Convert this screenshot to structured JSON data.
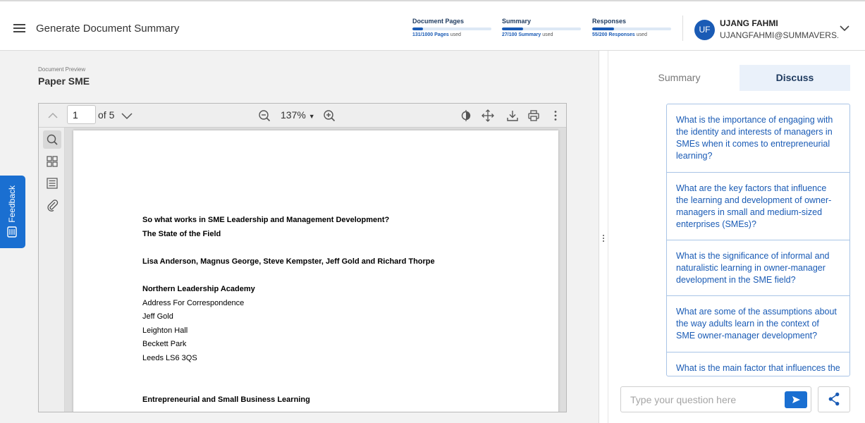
{
  "header": {
    "title": "Generate Document Summary",
    "usage": [
      {
        "label": "Document Pages",
        "used_value": "131/1000 Pages",
        "suffix": "used",
        "fraction": 0.131
      },
      {
        "label": "Summary",
        "used_value": "27/100 Summary",
        "suffix": "used",
        "fraction": 0.27
      },
      {
        "label": "Responses",
        "used_value": "55/200 Responses",
        "suffix": "used",
        "fraction": 0.275
      }
    ],
    "user": {
      "initials": "UF",
      "name": "UJANG FAHMI",
      "email": "UJANGFAHMI@SUMMAVERS..."
    }
  },
  "preview": {
    "label": "Document Preview",
    "title": "Paper SME"
  },
  "viewer": {
    "page_value": "1",
    "page_of": "of 5",
    "zoom": "137%",
    "document_lines": [
      {
        "text": "So what works in SME Leadership and Management Development?",
        "bold": true
      },
      {
        "text": "The State of the Field",
        "bold": true
      },
      {
        "text": "Lisa Anderson, Magnus George, Steve Kempster, Jeff Gold and Richard Thorpe",
        "bold": true
      },
      {
        "text": "Northern Leadership Academy",
        "bold": true
      },
      {
        "text": "Address For Correspondence",
        "bold": false
      },
      {
        "text": "Jeff Gold",
        "bold": false
      },
      {
        "text": "Leighton Hall",
        "bold": false
      },
      {
        "text": "Beckett Park",
        "bold": false
      },
      {
        "text": "Leeds LS6 3QS",
        "bold": false
      },
      {
        "text": "Entrepreneurial and Small Business Learning",
        "bold": true
      }
    ]
  },
  "feedback": {
    "label": "Feedback"
  },
  "tabs": {
    "summary": "Summary",
    "discuss": "Discuss"
  },
  "questions": [
    "What is the importance of engaging with the identity and interests of managers in SMEs when it comes to entrepreneurial learning?",
    "What are the key factors that influence the learning and development of owner-managers in small and medium-sized enterprises (SMEs)?",
    "What is the significance of informal and naturalistic learning in owner-manager development in the SME field?",
    "What are some of the assumptions about the way adults learn in the context of SME owner-manager development?",
    "What is the main factor that influences the decision of owner-managers..."
  ],
  "ask": {
    "placeholder": "Type your question here"
  },
  "colors": {
    "accent": "#1a5bb5",
    "feedback": "#1a6fd1",
    "active_tab_bg": "#eaf1fa"
  }
}
